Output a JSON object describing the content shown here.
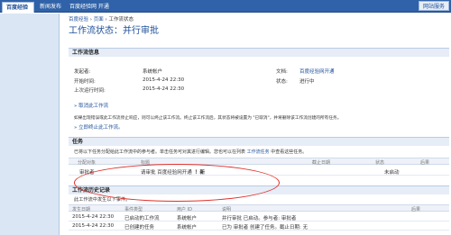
{
  "topbar": {
    "tabs": [
      "百度经验",
      "新闻发布",
      "百度经验网 开通"
    ],
    "right_button": "网站服务"
  },
  "breadcrumb": {
    "home": "百度经验",
    "sep": "›",
    "page": "页面",
    "current": "工作流状态"
  },
  "title": "工作流状态：并行审批",
  "info": {
    "section_title": "工作流信息",
    "initiator_label": "发起者:",
    "initiator_value": "系统帐户",
    "document_label": "文档:",
    "document_value": "百度经验网开通",
    "start_label": "开始时间:",
    "start_value": "2015-4-24 22:30",
    "status_label": "状态:",
    "status_value": "进行中",
    "last_run_label": "上次运行时间:",
    "last_run_value": "2015-4-24 22:30",
    "cancel_link": "» 取消此工作流",
    "notice": "如果出现错误或此工作流停止响应，则可以终止该工作流。终止该工作流后，其状态将被设置为 \"已取消\"，并将删除该工作流创建的所有任务。",
    "terminate_link": "» 立即终止此工作流。"
  },
  "tasks": {
    "section_title": "任务",
    "description_prefix": "已将以下任务分配给此工作流中的参与者。单击任务可对其进行编辑。您也可以在列表",
    "description_link": "工作流任务",
    "description_suffix": "中查看这些任务。",
    "columns": [
      "分配对象",
      "标题",
      "截止日期",
      "状态",
      "后果"
    ],
    "rows": [
      {
        "assignee": "审批者",
        "title": "请审批 百度经验网开通",
        "badge": "！新",
        "due": "",
        "status": "未启动",
        "outcome": ""
      }
    ]
  },
  "history": {
    "section_title": "工作流历史记录",
    "description": "此工作流中发生以下事件。",
    "columns": [
      "发生日期",
      "事件类型",
      "用户 ID",
      "说明",
      "后果"
    ],
    "rows": [
      {
        "date": "2015-4-24 22:30",
        "event": "已启动的工作流",
        "user": "系统帐户",
        "desc": "并行审批 已启动。参与者: 审批者",
        "outcome": ""
      },
      {
        "date": "2015-4-24 22:30",
        "event": "已创建的任务",
        "user": "系统帐户",
        "desc": "已为 审批者 创建了任务。截止日期: 无",
        "outcome": ""
      }
    ]
  },
  "colors": {
    "accent": "#1d4f9a",
    "topbar": "#2f62a8",
    "annotation": "#e0302a"
  }
}
